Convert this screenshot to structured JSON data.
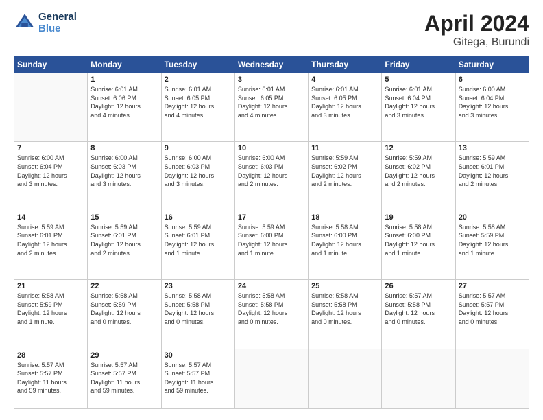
{
  "header": {
    "logo_line1": "General",
    "logo_line2": "Blue",
    "month": "April 2024",
    "location": "Gitega, Burundi"
  },
  "weekdays": [
    "Sunday",
    "Monday",
    "Tuesday",
    "Wednesday",
    "Thursday",
    "Friday",
    "Saturday"
  ],
  "weeks": [
    [
      {
        "day": "",
        "info": ""
      },
      {
        "day": "1",
        "info": "Sunrise: 6:01 AM\nSunset: 6:06 PM\nDaylight: 12 hours\nand 4 minutes."
      },
      {
        "day": "2",
        "info": "Sunrise: 6:01 AM\nSunset: 6:05 PM\nDaylight: 12 hours\nand 4 minutes."
      },
      {
        "day": "3",
        "info": "Sunrise: 6:01 AM\nSunset: 6:05 PM\nDaylight: 12 hours\nand 4 minutes."
      },
      {
        "day": "4",
        "info": "Sunrise: 6:01 AM\nSunset: 6:05 PM\nDaylight: 12 hours\nand 3 minutes."
      },
      {
        "day": "5",
        "info": "Sunrise: 6:01 AM\nSunset: 6:04 PM\nDaylight: 12 hours\nand 3 minutes."
      },
      {
        "day": "6",
        "info": "Sunrise: 6:00 AM\nSunset: 6:04 PM\nDaylight: 12 hours\nand 3 minutes."
      }
    ],
    [
      {
        "day": "7",
        "info": "Sunrise: 6:00 AM\nSunset: 6:04 PM\nDaylight: 12 hours\nand 3 minutes."
      },
      {
        "day": "8",
        "info": "Sunrise: 6:00 AM\nSunset: 6:03 PM\nDaylight: 12 hours\nand 3 minutes."
      },
      {
        "day": "9",
        "info": "Sunrise: 6:00 AM\nSunset: 6:03 PM\nDaylight: 12 hours\nand 3 minutes."
      },
      {
        "day": "10",
        "info": "Sunrise: 6:00 AM\nSunset: 6:03 PM\nDaylight: 12 hours\nand 2 minutes."
      },
      {
        "day": "11",
        "info": "Sunrise: 5:59 AM\nSunset: 6:02 PM\nDaylight: 12 hours\nand 2 minutes."
      },
      {
        "day": "12",
        "info": "Sunrise: 5:59 AM\nSunset: 6:02 PM\nDaylight: 12 hours\nand 2 minutes."
      },
      {
        "day": "13",
        "info": "Sunrise: 5:59 AM\nSunset: 6:01 PM\nDaylight: 12 hours\nand 2 minutes."
      }
    ],
    [
      {
        "day": "14",
        "info": "Sunrise: 5:59 AM\nSunset: 6:01 PM\nDaylight: 12 hours\nand 2 minutes."
      },
      {
        "day": "15",
        "info": "Sunrise: 5:59 AM\nSunset: 6:01 PM\nDaylight: 12 hours\nand 2 minutes."
      },
      {
        "day": "16",
        "info": "Sunrise: 5:59 AM\nSunset: 6:01 PM\nDaylight: 12 hours\nand 1 minute."
      },
      {
        "day": "17",
        "info": "Sunrise: 5:59 AM\nSunset: 6:00 PM\nDaylight: 12 hours\nand 1 minute."
      },
      {
        "day": "18",
        "info": "Sunrise: 5:58 AM\nSunset: 6:00 PM\nDaylight: 12 hours\nand 1 minute."
      },
      {
        "day": "19",
        "info": "Sunrise: 5:58 AM\nSunset: 6:00 PM\nDaylight: 12 hours\nand 1 minute."
      },
      {
        "day": "20",
        "info": "Sunrise: 5:58 AM\nSunset: 5:59 PM\nDaylight: 12 hours\nand 1 minute."
      }
    ],
    [
      {
        "day": "21",
        "info": "Sunrise: 5:58 AM\nSunset: 5:59 PM\nDaylight: 12 hours\nand 1 minute."
      },
      {
        "day": "22",
        "info": "Sunrise: 5:58 AM\nSunset: 5:59 PM\nDaylight: 12 hours\nand 0 minutes."
      },
      {
        "day": "23",
        "info": "Sunrise: 5:58 AM\nSunset: 5:58 PM\nDaylight: 12 hours\nand 0 minutes."
      },
      {
        "day": "24",
        "info": "Sunrise: 5:58 AM\nSunset: 5:58 PM\nDaylight: 12 hours\nand 0 minutes."
      },
      {
        "day": "25",
        "info": "Sunrise: 5:58 AM\nSunset: 5:58 PM\nDaylight: 12 hours\nand 0 minutes."
      },
      {
        "day": "26",
        "info": "Sunrise: 5:57 AM\nSunset: 5:58 PM\nDaylight: 12 hours\nand 0 minutes."
      },
      {
        "day": "27",
        "info": "Sunrise: 5:57 AM\nSunset: 5:57 PM\nDaylight: 12 hours\nand 0 minutes."
      }
    ],
    [
      {
        "day": "28",
        "info": "Sunrise: 5:57 AM\nSunset: 5:57 PM\nDaylight: 11 hours\nand 59 minutes."
      },
      {
        "day": "29",
        "info": "Sunrise: 5:57 AM\nSunset: 5:57 PM\nDaylight: 11 hours\nand 59 minutes."
      },
      {
        "day": "30",
        "info": "Sunrise: 5:57 AM\nSunset: 5:57 PM\nDaylight: 11 hours\nand 59 minutes."
      },
      {
        "day": "",
        "info": ""
      },
      {
        "day": "",
        "info": ""
      },
      {
        "day": "",
        "info": ""
      },
      {
        "day": "",
        "info": ""
      }
    ]
  ]
}
